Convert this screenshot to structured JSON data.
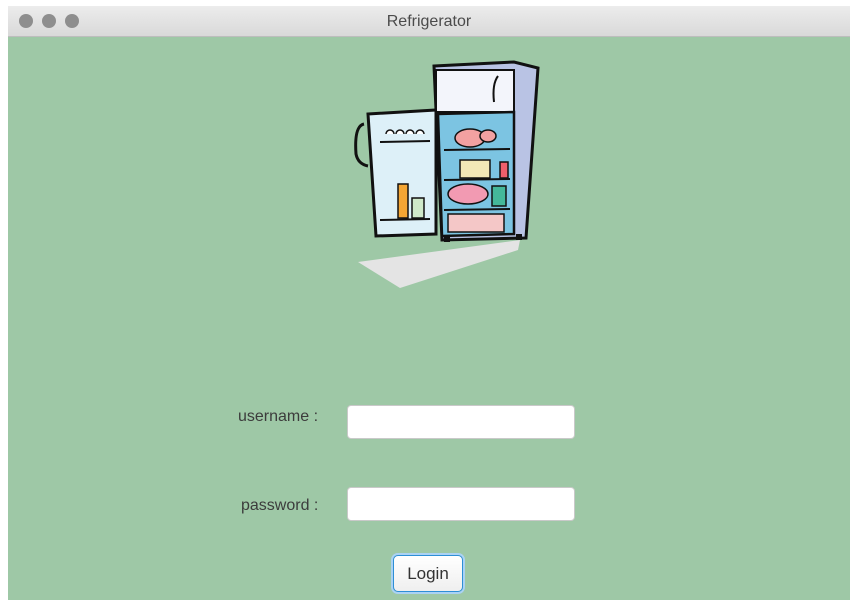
{
  "window": {
    "title": "Refrigerator"
  },
  "form": {
    "username_label": "username :",
    "password_label": "password :",
    "username_value": "",
    "password_value": "",
    "login_label": "Login"
  },
  "colors": {
    "background": "#9ec8a6",
    "button_focus": "#2d8fd6"
  },
  "icons": [
    "close-button-icon",
    "minimize-button-icon",
    "zoom-button-icon",
    "refrigerator-illustration"
  ]
}
